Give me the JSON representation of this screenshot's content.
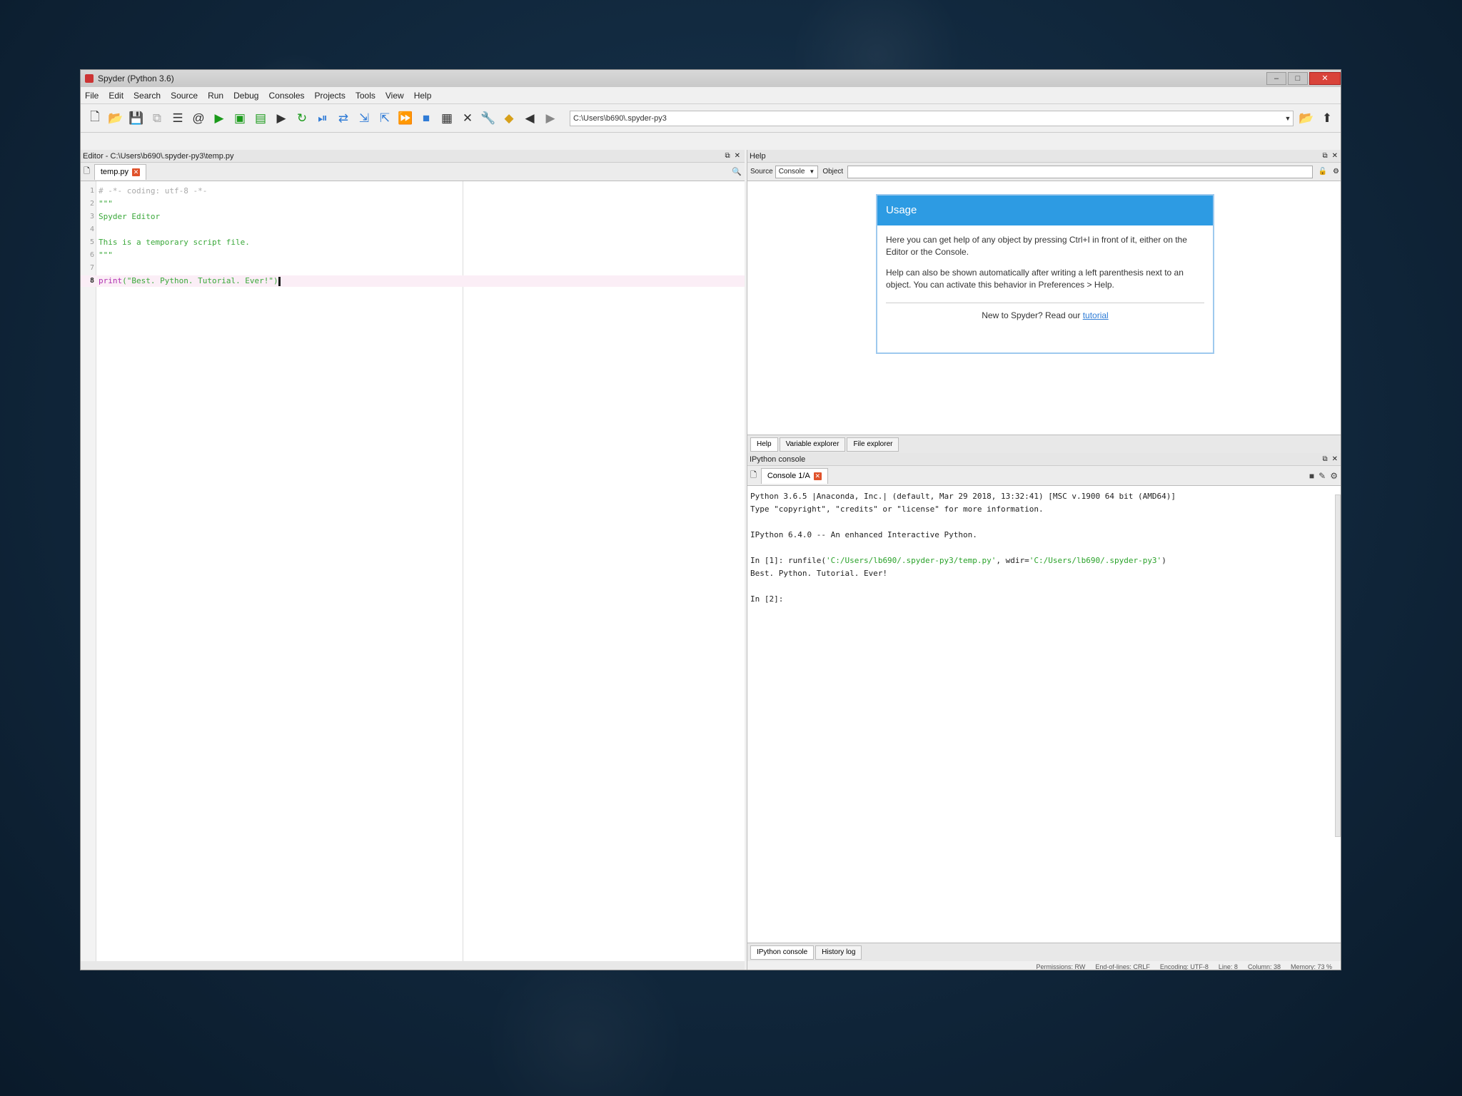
{
  "window": {
    "title": "Spyder (Python 3.6)",
    "controls": {
      "minimize": "–",
      "maximize": "□",
      "close": "✕"
    }
  },
  "menu": [
    "File",
    "Edit",
    "Search",
    "Source",
    "Run",
    "Debug",
    "Consoles",
    "Projects",
    "Tools",
    "View",
    "Help"
  ],
  "toolbar": {
    "path": "C:\\Users\\b690\\.spyder-py3",
    "icons": [
      "new-file-icon",
      "open-folder-icon",
      "save-icon",
      "save-all-icon",
      "outline-icon",
      "at-icon",
      "run-icon",
      "run-cell-icon",
      "run-cell-advance-icon",
      "run-selection-icon",
      "rerun-icon",
      "debug-icon",
      "step-icon",
      "step-into-icon",
      "step-return-icon",
      "continue-icon",
      "stop-icon",
      "maximize-pane-icon",
      "fullscreen-icon",
      "preferences-icon",
      "python-path-icon",
      "back-arrow-icon",
      "forward-arrow-icon"
    ]
  },
  "editor": {
    "title": "Editor - C:\\Users\\b690\\.spyder-py3\\temp.py",
    "tab": "temp.py",
    "lines": [
      {
        "n": "1",
        "text": "# -*- coding: utf-8 -*-"
      },
      {
        "n": "2",
        "text": "\"\"\""
      },
      {
        "n": "3",
        "text": "Spyder Editor"
      },
      {
        "n": "4",
        "text": ""
      },
      {
        "n": "5",
        "text": "This is a temporary script file."
      },
      {
        "n": "6",
        "text": "\"\"\""
      },
      {
        "n": "7",
        "text": ""
      },
      {
        "n": "8",
        "kw": "print",
        "arg": "(\"Best. Python. Tutorial. Ever!\")"
      }
    ]
  },
  "help": {
    "title": "Help",
    "source_label": "Source",
    "source_value": "Console",
    "object_label": "Object",
    "card": {
      "heading": "Usage",
      "p1": "Here you can get help of any object by pressing Ctrl+I in front of it, either on the Editor or the Console.",
      "p2": "Help can also be shown automatically after writing a left parenthesis next to an object. You can activate this behavior in Preferences > Help.",
      "foot_text": "New to Spyder? Read our",
      "foot_link": "tutorial"
    },
    "tabs": [
      "Help",
      "Variable explorer",
      "File explorer"
    ]
  },
  "console": {
    "title": "IPython console",
    "tab": "Console 1/A",
    "lines": {
      "l1": "Python 3.6.5 |Anaconda, Inc.| (default, Mar 29 2018, 13:32:41) [MSC v.1900 64 bit (AMD64)]",
      "l2": "Type \"copyright\", \"credits\" or \"license\" for more information.",
      "l3": "IPython 6.4.0 -- An enhanced Interactive Python.",
      "l4_pre": "In [1]: runfile(",
      "l4_file": "'C:/Users/lb690/.spyder-py3/temp.py'",
      "l4_mid": ", wdir=",
      "l4_dir": "'C:/Users/lb690/.spyder-py3'",
      "l4_post": ")",
      "l5": "Best. Python. Tutorial. Ever!",
      "l6": "In [2]:"
    },
    "tabs": [
      "IPython console",
      "History log"
    ]
  },
  "status": {
    "permissions": "Permissions: RW",
    "eol": "End-of-lines: CRLF",
    "encoding": "Encoding: UTF-8",
    "line": "Line: 8",
    "column": "Column: 38",
    "memory": "Memory: 73 %"
  }
}
